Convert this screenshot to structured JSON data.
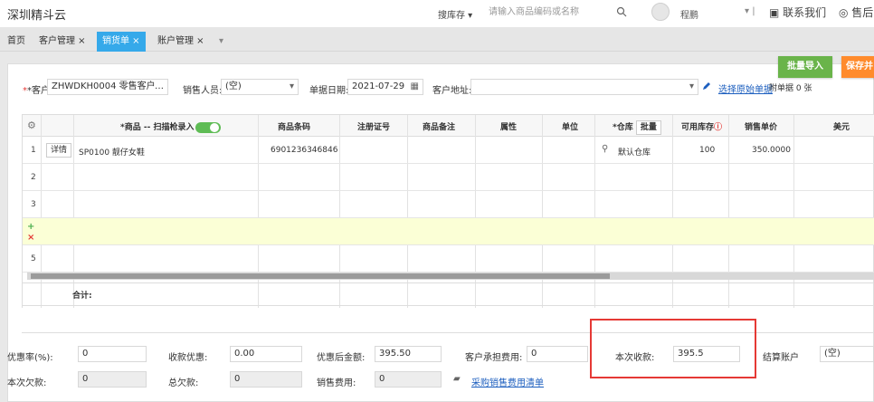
{
  "topbar": {
    "brand": "深圳精斗云",
    "search_type": "搜库存 ▾",
    "search_placeholder": "请输入商品编码或名称",
    "user": "程鹏",
    "contact": "联系我们",
    "after_sales": "售后"
  },
  "tabs": [
    {
      "label": "首页"
    },
    {
      "label": "客户管理 ×"
    },
    {
      "label": "销货单 ×"
    },
    {
      "label": "账户管理 ×"
    },
    {
      "label": "▾"
    }
  ],
  "actions": {
    "batch_import": "批量导入",
    "save": "保存并"
  },
  "form": {
    "customer_label": "*客户:",
    "customer_value": "ZHWDKH0004 零售客户",
    "customer_more": "…",
    "sales_label": "销售人员:",
    "sales_value": "(空)",
    "date_label": "单据日期:",
    "date_value": "2021-07-29",
    "address_label": "客户地址:",
    "choose_source": "选择原始单据",
    "attachment": "附单据 0 张"
  },
  "table": {
    "headers": [
      "*商品 -- 扫描枪录入",
      "商品条码",
      "注册证号",
      "商品备注",
      "属性",
      "单位",
      "*仓库",
      "批量",
      "可用库存",
      "销售单价",
      "美元"
    ],
    "rows": [
      {
        "num": "1",
        "detail": "详情",
        "product": "SP0100 靓仔女鞋",
        "barcode": "6901236346846",
        "warehouse": "默认仓库",
        "stock": "100",
        "price": "350.0000"
      },
      {
        "num": "2"
      },
      {
        "num": "3"
      },
      {
        "num": ""
      },
      {
        "num": "5"
      }
    ],
    "sum_label": "合计:"
  },
  "bottom": {
    "discount_rate_label": "优惠率(%):",
    "discount_rate_value": "0",
    "collect_discount_label": "收款优惠:",
    "collect_discount_value": "0.00",
    "after_discount_label": "优惠后金额:",
    "after_discount_value": "395.50",
    "customer_fee_label": "客户承担费用:",
    "customer_fee_value": "0",
    "this_receipt_label": "本次收款:",
    "this_receipt_value": "395.5",
    "settle_account_label": "结算账户",
    "settle_account_value": "(空)",
    "this_debt_label": "本次欠款:",
    "this_debt_value": "0",
    "total_debt_label": "总欠款:",
    "total_debt_value": "0",
    "sales_fee_label": "销售费用:",
    "sales_fee_value": "0",
    "purchase_fee_link": "采购销售费用清单"
  }
}
